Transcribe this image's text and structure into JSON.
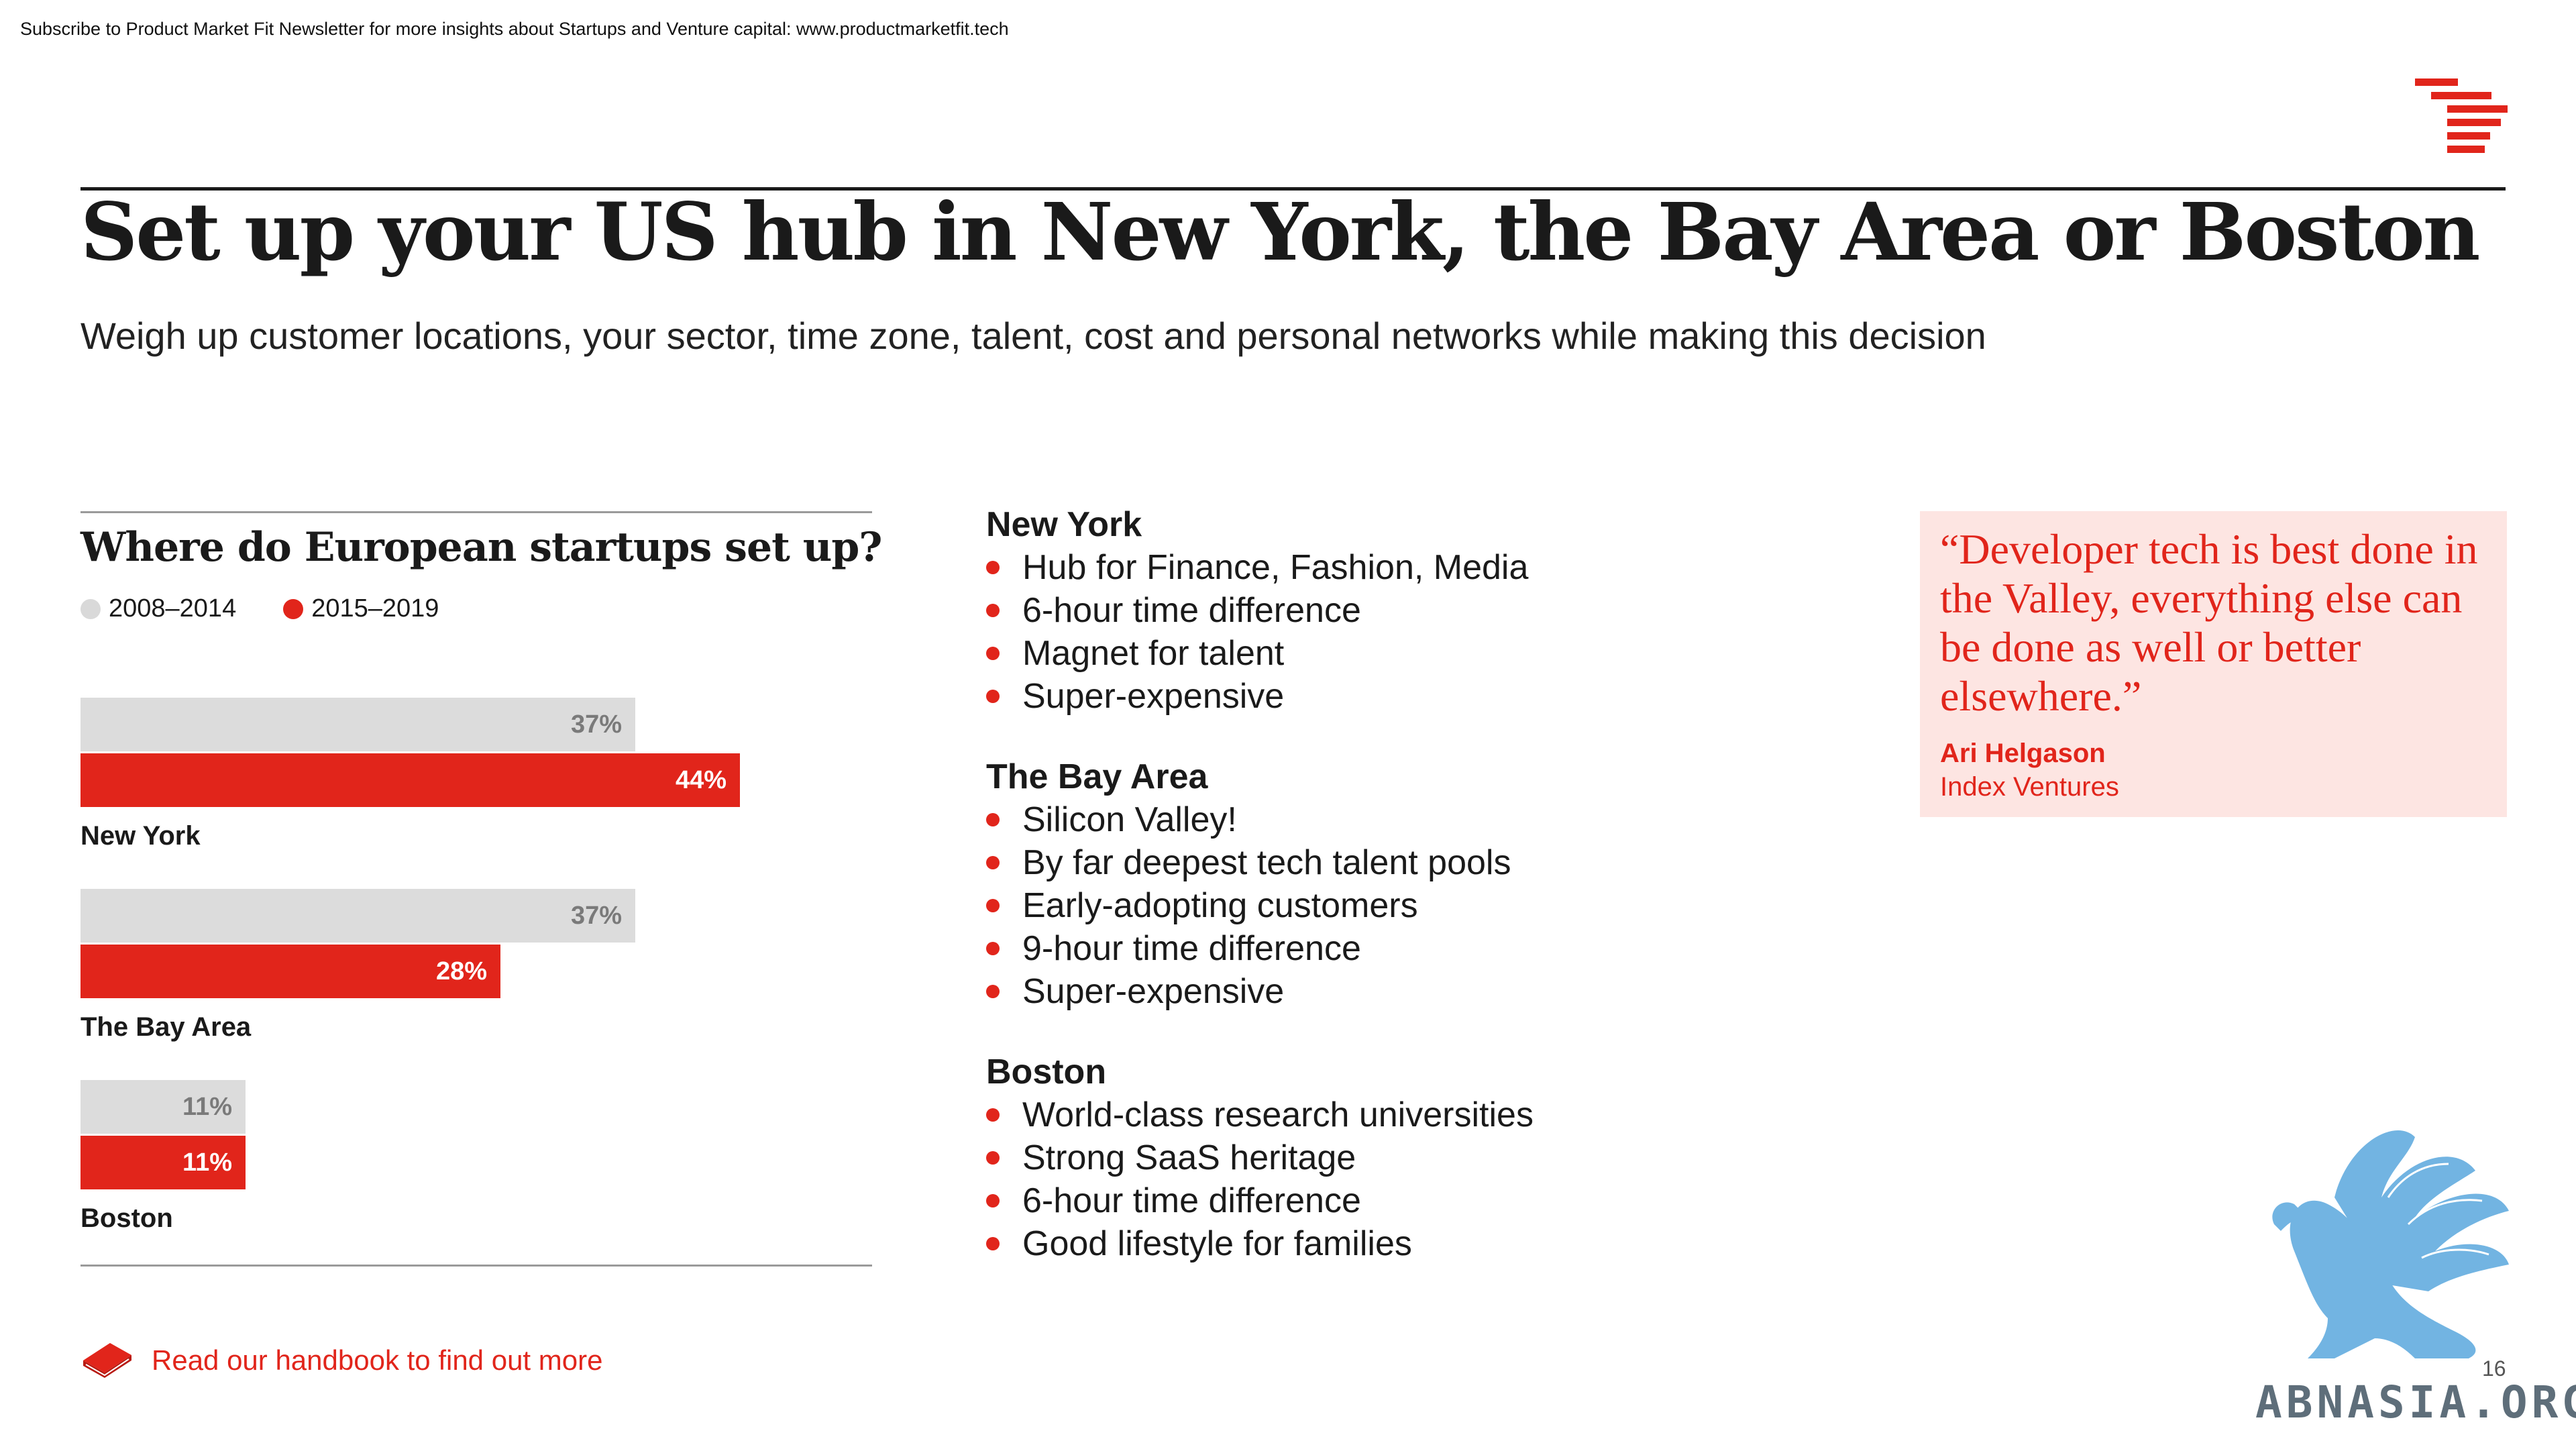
{
  "header": {
    "top_note": "Subscribe to Product Market Fit Newsletter for more insights about Startups and Venture capital:  www.productmarketfit.tech",
    "title": "Set up your US hub in New York, the Bay Area or Boston",
    "subtitle": "Weigh up customer locations, your sector, time zone, talent, cost and personal networks while making this decision"
  },
  "colors": {
    "accent": "#e1251b",
    "grey_bar": "#dcdcdc",
    "grey_text": "#7a7a7a",
    "quote_bg": "#fde5e2",
    "dot_grey": "#d9d9d9"
  },
  "chart_data": {
    "type": "bar",
    "orientation": "horizontal",
    "title": "Where do European startups set up?",
    "categories": [
      "New York",
      "The Bay Area",
      "Boston"
    ],
    "series": [
      {
        "name": "2008–2014",
        "values": [
          37,
          37,
          11
        ],
        "labels": [
          "37%",
          "37%",
          "11%"
        ],
        "color": "#dcdcdc",
        "label_color": "#7a7a7a"
      },
      {
        "name": "2015–2019",
        "values": [
          44,
          28,
          11
        ],
        "labels": [
          "44%",
          "28%",
          "11%"
        ],
        "color": "#e1251b",
        "label_color": "#ffffff"
      }
    ],
    "xlim": [
      0,
      50
    ],
    "grid": false,
    "legend_position": "top-left"
  },
  "locations": [
    {
      "name": "New York",
      "items": [
        "Hub for Finance, Fashion, Media",
        "6-hour time difference",
        "Magnet for talent",
        "Super-expensive"
      ]
    },
    {
      "name": "The Bay Area",
      "items": [
        "Silicon Valley!",
        "By far deepest tech talent pools",
        "Early-adopting customers",
        "9-hour time difference",
        "Super-expensive"
      ]
    },
    {
      "name": "Boston",
      "items": [
        "World-class research universities",
        "Strong SaaS heritage",
        "6-hour time difference",
        "Good lifestyle for families"
      ]
    }
  ],
  "quote": {
    "text": "“Developer tech is best done in the Valley, everything else can be done as well or better elsewhere.”",
    "author": "Ari Helgason",
    "organization": "Index Ventures"
  },
  "footer": {
    "link_text": "Read our handbook to find out more",
    "page_number": "16",
    "watermark": "ABNASIA.ORG",
    "book_icon": "book-icon"
  }
}
